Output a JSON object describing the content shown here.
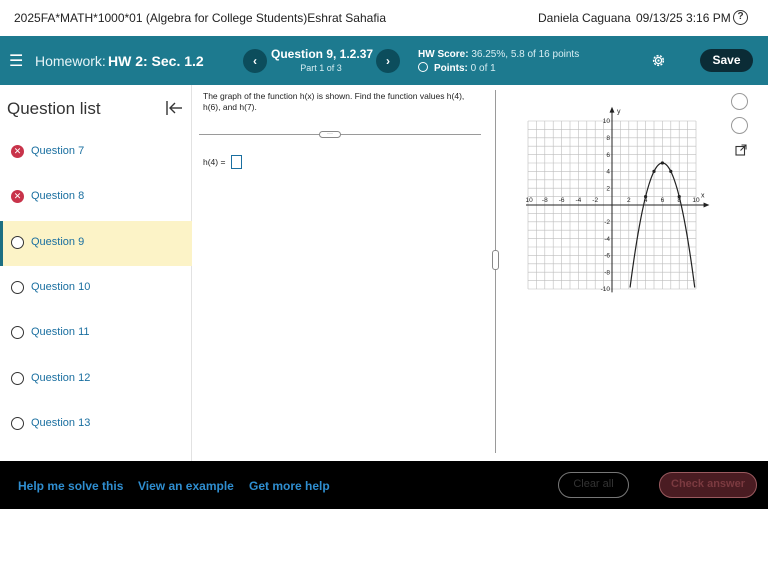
{
  "topbar": {
    "course_title": "2025FA*MATH*1000*01 (Algebra for College Students)Eshrat Sahafia",
    "user_name": "Daniela Caguana",
    "timestamp": "09/13/25 3:16 PM",
    "help_icon": "question-circle-icon"
  },
  "hwbar": {
    "menu_icon": "hamburger-icon",
    "label": "Homework:",
    "name": "HW 2: Sec. 1.2",
    "prev_icon": "chevron-left-icon",
    "next_icon": "chevron-right-icon",
    "prev_label": "‹",
    "next_label": "›",
    "question_title": "Question 9, 1.2.37",
    "question_part": "Part 1 of 3",
    "score_label": "HW Score:",
    "score_value": "36.25%, 5.8 of 16 points",
    "points_label": "Points:",
    "points_value": "0 of 1",
    "settings_icon": "gear-icon",
    "save_label": "Save",
    "colors": {
      "bar": "#1d7a8f",
      "save": "#0b2c36"
    }
  },
  "sidebar": {
    "heading": "Question list",
    "collapse_icon": "collapse-left-icon",
    "items": [
      {
        "label": "Question 7",
        "status": "incorrect",
        "active": false,
        "mark": "✕"
      },
      {
        "label": "Question 8",
        "status": "incorrect",
        "active": false,
        "mark": "✕"
      },
      {
        "label": "Question 9",
        "status": "unanswered",
        "active": true
      },
      {
        "label": "Question 10",
        "status": "unanswered",
        "active": false
      },
      {
        "label": "Question 11",
        "status": "unanswered",
        "active": false
      },
      {
        "label": "Question 12",
        "status": "unanswered",
        "active": false
      },
      {
        "label": "Question 13",
        "status": "unanswered",
        "active": false
      }
    ]
  },
  "question": {
    "prompt": "The graph of the function h(x) is shown. Find the function values h(4), h(6), and h(7).",
    "answer_label": "h(4) =",
    "answer_value": ""
  },
  "graph": {
    "x_label": "x",
    "y_label": "y",
    "x_ticks": [
      "-10",
      "-8",
      "-6",
      "-4",
      "-2",
      "2",
      "4",
      "6",
      "8",
      "10"
    ],
    "y_ticks": [
      "10",
      "8",
      "6",
      "4",
      "2",
      "-2",
      "-4",
      "-6",
      "-8",
      "-10"
    ],
    "function": "h(x) = -(x-6)^2 + 5",
    "vertex": [
      6,
      5
    ],
    "marked_points": [
      [
        4,
        1
      ],
      [
        5,
        4
      ],
      [
        6,
        5
      ],
      [
        7,
        4
      ],
      [
        8,
        1
      ]
    ],
    "curve_x_range": [
      1.9,
      10
    ],
    "curve_color": "#222222"
  },
  "bottombar": {
    "help_solve": "Help me solve this",
    "view_example": "View an example",
    "more_help": "Get more help",
    "clear_all": "Clear all",
    "check_answer": "Check answer",
    "colors": {
      "links": "#2f8ed0",
      "check": "#4a1c22"
    }
  }
}
